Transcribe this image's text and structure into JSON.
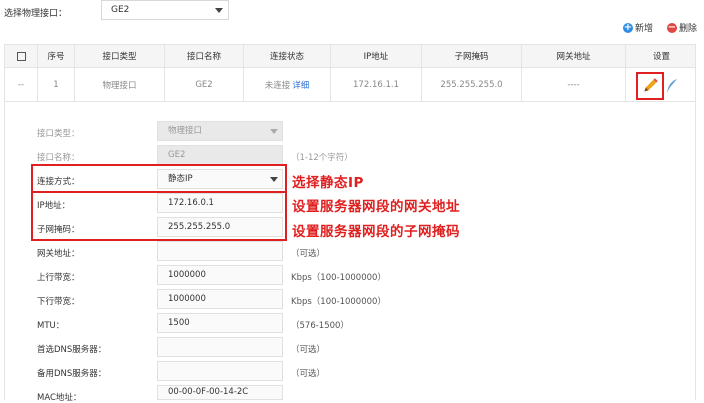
{
  "top": {
    "port_label": "选择物理接口：",
    "port_value": "GE2",
    "add_label": "新增",
    "delete_label": "删除"
  },
  "table": {
    "headers": [
      "序号",
      "接口类型",
      "接口名称",
      "连接状态",
      "IP地址",
      "子网掩码",
      "网关地址",
      "设置"
    ],
    "row": {
      "check": "--",
      "index": "1",
      "type": "物理接口",
      "name": "GE2",
      "status": "未连接",
      "detail": "详细",
      "ip": "172.16.1.1",
      "mask": "255.255.255.0",
      "gateway": "----"
    }
  },
  "form": {
    "iface_type_label": "接口类型：",
    "iface_type_value": "物理接口",
    "iface_name_label": "接口名称：",
    "iface_name_value": "GE2",
    "iface_name_hint": "（1-12个字符）",
    "conn_label": "连接方式：",
    "conn_value": "静态IP",
    "ip_label": "IP地址：",
    "ip_value": "172.16.0.1",
    "mask_label": "子网掩码：",
    "mask_value": "255.255.255.0",
    "gateway_label": "网关地址：",
    "gateway_hint": "（可选）",
    "up_label": "上行带宽：",
    "up_value": "1000000",
    "up_hint": "Kbps（100-1000000）",
    "down_label": "下行带宽：",
    "down_value": "1000000",
    "down_hint": "Kbps（100-1000000）",
    "mtu_label": "MTU：",
    "mtu_value": "1500",
    "mtu_hint": "（576-1500）",
    "dns1_label": "首选DNS服务器：",
    "dns1_hint": "（可选）",
    "dns2_label": "备用DNS服务器：",
    "dns2_hint": "（可选）",
    "mac_label": "MAC地址：",
    "mac_value": "00-00-0F-00-14-2C"
  },
  "annotations": {
    "a1": "选择静态IP",
    "a2": "设置服务器网段的网关地址",
    "a3": "设置服务器网段的子网掩码"
  },
  "colors": {
    "annotation_red": "#e02020",
    "add_blue": "#2f8ee5",
    "delete_red": "#e0473f"
  }
}
